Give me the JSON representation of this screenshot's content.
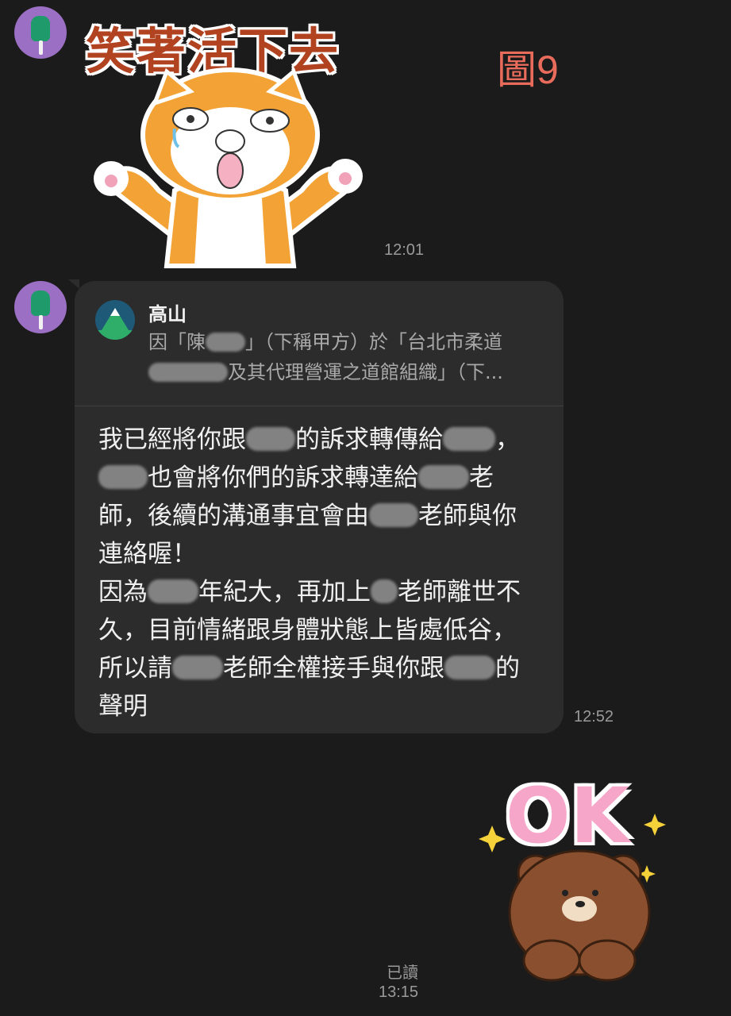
{
  "sticker1": {
    "title": "笑著活下去",
    "time": "12:01"
  },
  "figure_label": "圖9",
  "link_preview": {
    "source_name": "高山",
    "snippet_line1": "因「陳",
    "snippet_line1b": "」（下稱甲方）於「台北市柔道",
    "snippet_line2": "及其代理營運之道館組織」（下..."
  },
  "message": {
    "line1a": "我已經將你跟",
    "line1b": "的訴求轉傳給",
    "line1c": "，",
    "line2a": "也會將你們的訴求轉達給",
    "line2b": "老",
    "line3a": "師，後續的溝通事宜會由",
    "line3b": "老師與你",
    "line4": "連絡喔！",
    "line5a": "因為",
    "line5b": "年紀大，再加上",
    "line5c": "老師離世不",
    "line6": "久，目前情緒跟身體狀態上皆處低谷，",
    "line7a": "所以請",
    "line7b": "老師全權接手與你跟",
    "line7c": "的",
    "line8": "聲明",
    "time": "12:52"
  },
  "sticker2": {
    "text": "OK",
    "read_label": "已讀",
    "time": "13:15"
  },
  "colors": {
    "background": "#1b1b1b",
    "bubble": "#2c2c2c",
    "avatar": "#9b6fc4"
  }
}
